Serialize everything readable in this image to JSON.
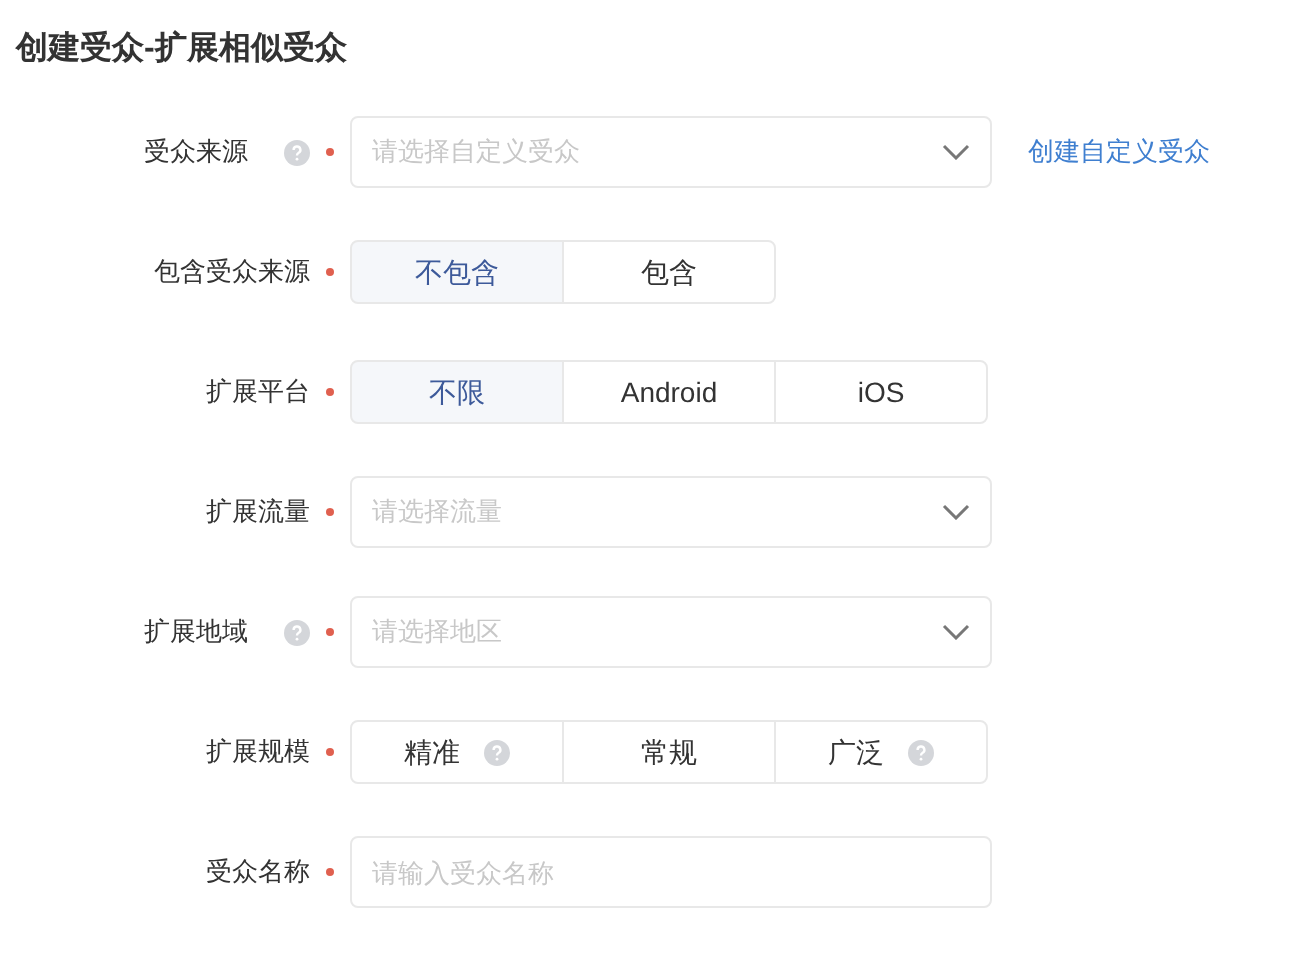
{
  "title": "创建受众-扩展相似受众",
  "fields": [
    {
      "kind": "select",
      "label": "受众来源",
      "help": true,
      "required": true,
      "placeholder": "请选择自定义受众",
      "link": "创建自定义受众"
    },
    {
      "kind": "segmented",
      "label": "包含受众来源",
      "help": false,
      "required": true,
      "options": [
        {
          "label": "不包含",
          "selected": true,
          "help": false
        },
        {
          "label": "包含",
          "selected": false,
          "help": false
        }
      ]
    },
    {
      "kind": "segmented",
      "label": "扩展平台",
      "help": false,
      "required": true,
      "options": [
        {
          "label": "不限",
          "selected": true,
          "help": false
        },
        {
          "label": "Android",
          "selected": false,
          "help": false
        },
        {
          "label": "iOS",
          "selected": false,
          "help": false
        }
      ]
    },
    {
      "kind": "select",
      "label": "扩展流量",
      "help": false,
      "required": true,
      "placeholder": "请选择流量"
    },
    {
      "kind": "select",
      "label": "扩展地域",
      "help": true,
      "required": true,
      "placeholder": "请选择地区"
    },
    {
      "kind": "segmented",
      "label": "扩展规模",
      "help": false,
      "required": true,
      "options": [
        {
          "label": "精准",
          "selected": false,
          "help": true
        },
        {
          "label": "常规",
          "selected": false,
          "help": false
        },
        {
          "label": "广泛",
          "selected": false,
          "help": true
        }
      ]
    },
    {
      "kind": "input",
      "label": "受众名称",
      "help": false,
      "required": true,
      "placeholder": "请输入受众名称"
    }
  ]
}
